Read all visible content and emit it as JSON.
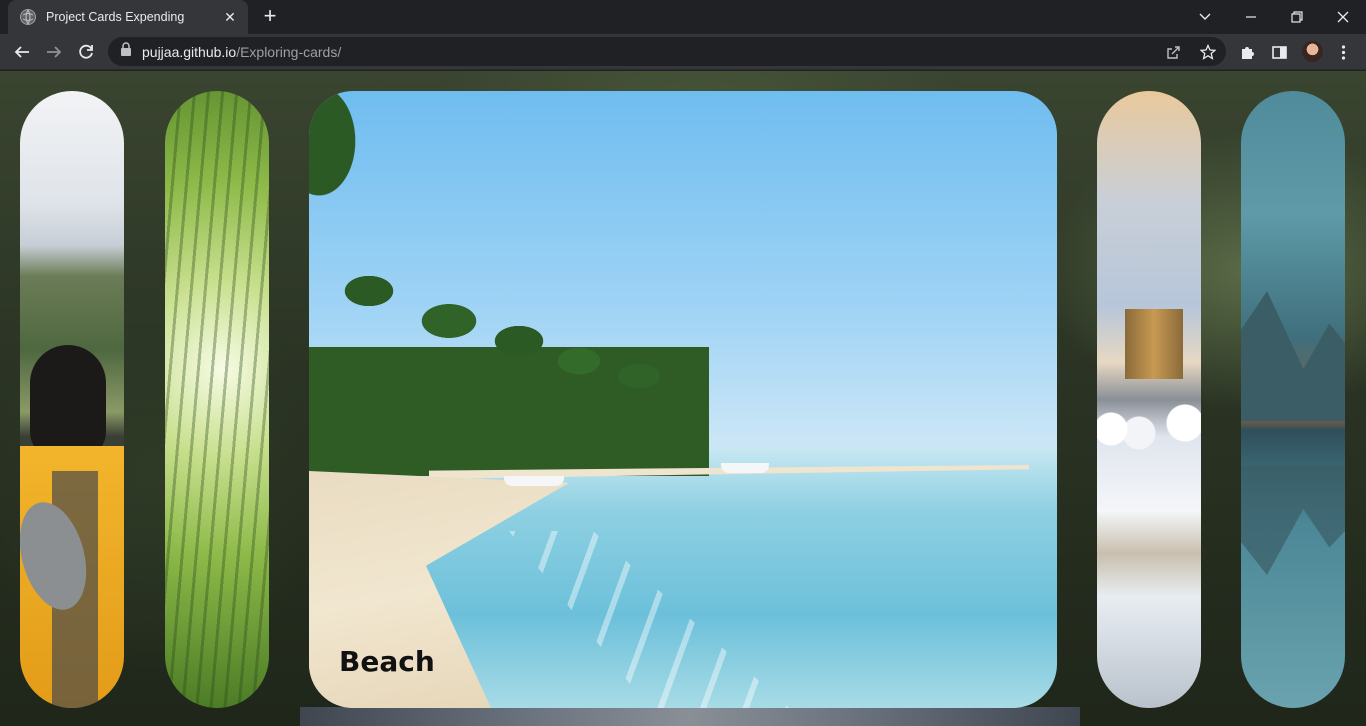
{
  "browser": {
    "tab_title": "Project Cards Expending",
    "url_host": "pujjaa.github.io",
    "url_path": "/Exploring-cards/"
  },
  "cards": [
    {
      "id": "hiker",
      "label": "",
      "expanded": false
    },
    {
      "id": "bamboo",
      "label": "",
      "expanded": false
    },
    {
      "id": "beach",
      "label": "Beach",
      "expanded": true
    },
    {
      "id": "snow-city",
      "label": "",
      "expanded": false
    },
    {
      "id": "mountain-lake",
      "label": "",
      "expanded": false
    }
  ],
  "icons": {
    "favicon": "globe-icon",
    "tab_close": "close-icon",
    "new_tab": "plus-icon",
    "back": "arrow-left-icon",
    "forward": "arrow-right-icon",
    "reload": "reload-icon",
    "lock": "lock-icon",
    "share": "share-icon",
    "bookmark": "star-icon",
    "extensions": "puzzle-icon",
    "side_panel": "side-panel-icon",
    "menu": "kebab-menu-icon"
  },
  "colors": {
    "chrome_bg": "#202124",
    "toolbar_bg": "#35363a",
    "label_text": "#111111"
  }
}
